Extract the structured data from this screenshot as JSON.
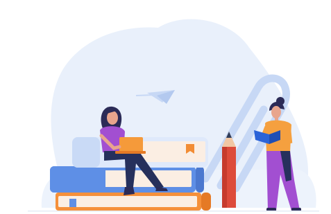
{
  "illustration": {
    "subject": "study-scene",
    "colors": {
      "background_blob": "#e9f0fb",
      "book_orange": "#f5903a",
      "book_orange_dark": "#e57a25",
      "book_blue": "#5e8fe6",
      "book_blue_dark": "#4b78cf",
      "book_light": "#dfe9fb",
      "pages": "#fbeee3",
      "bookmark": "#f28c34",
      "paperclip": "#c7d8f5",
      "pencil_body": "#dd4b3b",
      "pencil_wood": "#f1c7a4",
      "pencil_tip": "#2f3e5c",
      "hair": "#2b2b57",
      "skin": "#e8a58d",
      "shirt_purple": "#a24fd1",
      "pants_navy": "#26305c",
      "laptop": "#f59a3a",
      "shirt_orange": "#f5a03f",
      "open_book": "#2b63d8",
      "paper_plane": "#c7d8f5"
    }
  }
}
